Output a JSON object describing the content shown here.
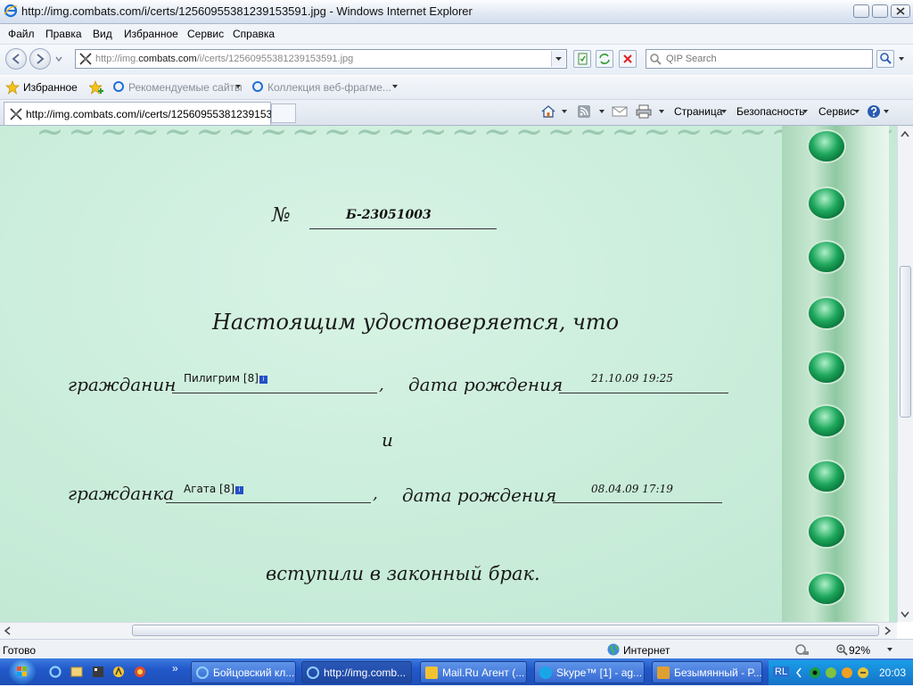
{
  "window": {
    "title": "http://img.combats.com/i/certs/12560955381239153591.jpg - Windows Internet Explorer"
  },
  "menu": {
    "items": [
      "Файл",
      "Правка",
      "Вид",
      "Избранное",
      "Сервис",
      "Справка"
    ]
  },
  "address": {
    "url_prefix": "http://img.",
    "url_domain": "combats.com",
    "url_path": "/i/certs/12560955381239153591.jpg"
  },
  "search": {
    "placeholder": "QIP Search"
  },
  "favorites": {
    "label": "Избранное",
    "recommended": "Рекомендуемые сайты",
    "webslices": "Коллекция веб-фрагме..."
  },
  "tab": {
    "title": "http://img.combats.com/i/certs/125609553812391535..."
  },
  "commandbar": {
    "page": "Страница",
    "safety": "Безопасность",
    "tools": "Сервис"
  },
  "certificate": {
    "number_prefix": "№",
    "number": "Б-23051003",
    "headline": "Настоящим удостоверяется, что",
    "citizen_label": "гражданин",
    "citizen_name": "Пилигрим",
    "citizen_level": "[8]",
    "birth_label": "дата рождения",
    "citizen_birth": "21.10.09 19:25",
    "and": "и",
    "citizeness_label": "гражданка",
    "citizeness_name": "Агата",
    "citizeness_level": "[8]",
    "citizeness_birth": "08.04.09 17:19",
    "married": "вступили в законный брак.",
    "info_glyph": "i"
  },
  "status": {
    "text": "Готово",
    "zone": "Интернет",
    "zoom": "92%"
  },
  "taskbar": {
    "items": [
      {
        "label": "Бойцовский кл...",
        "color": "#2f7be0"
      },
      {
        "label": "http://img.comb...",
        "color": "#2f7be0"
      },
      {
        "label": "Mail.Ru Агент (...",
        "color": "#f2c230"
      },
      {
        "label": "Skype™ [1] - ag...",
        "color": "#19a6e8"
      },
      {
        "label": "Безымянный - P...",
        "color": "#e0a030"
      }
    ],
    "clock": "20:03",
    "lang": "RL"
  }
}
